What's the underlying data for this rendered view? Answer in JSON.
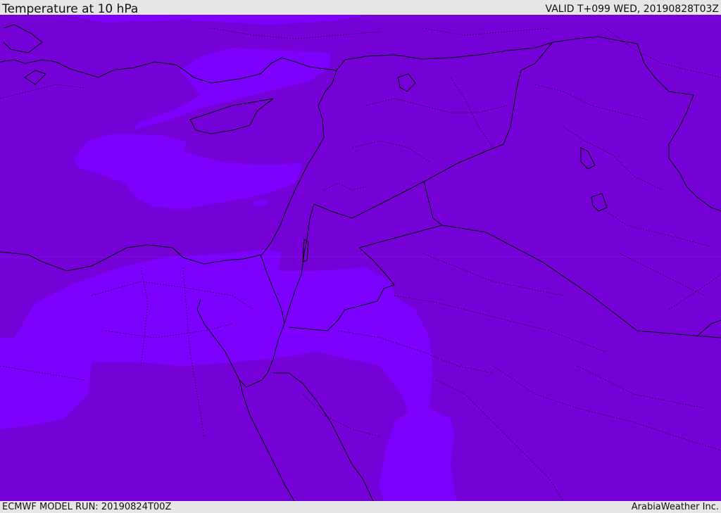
{
  "header": {
    "title": "Temperature at 10 hPa",
    "valid_time": "VALID T+099 WED, 20190828T03Z"
  },
  "footer": {
    "model_run": "ECMWF MODEL RUN: 20190824T00Z",
    "credit": "ArabiaWeather Inc."
  },
  "map": {
    "colors": {
      "base_fill": "#7600d8",
      "warm_fill": "#7d00ff",
      "border": "#000000"
    }
  }
}
